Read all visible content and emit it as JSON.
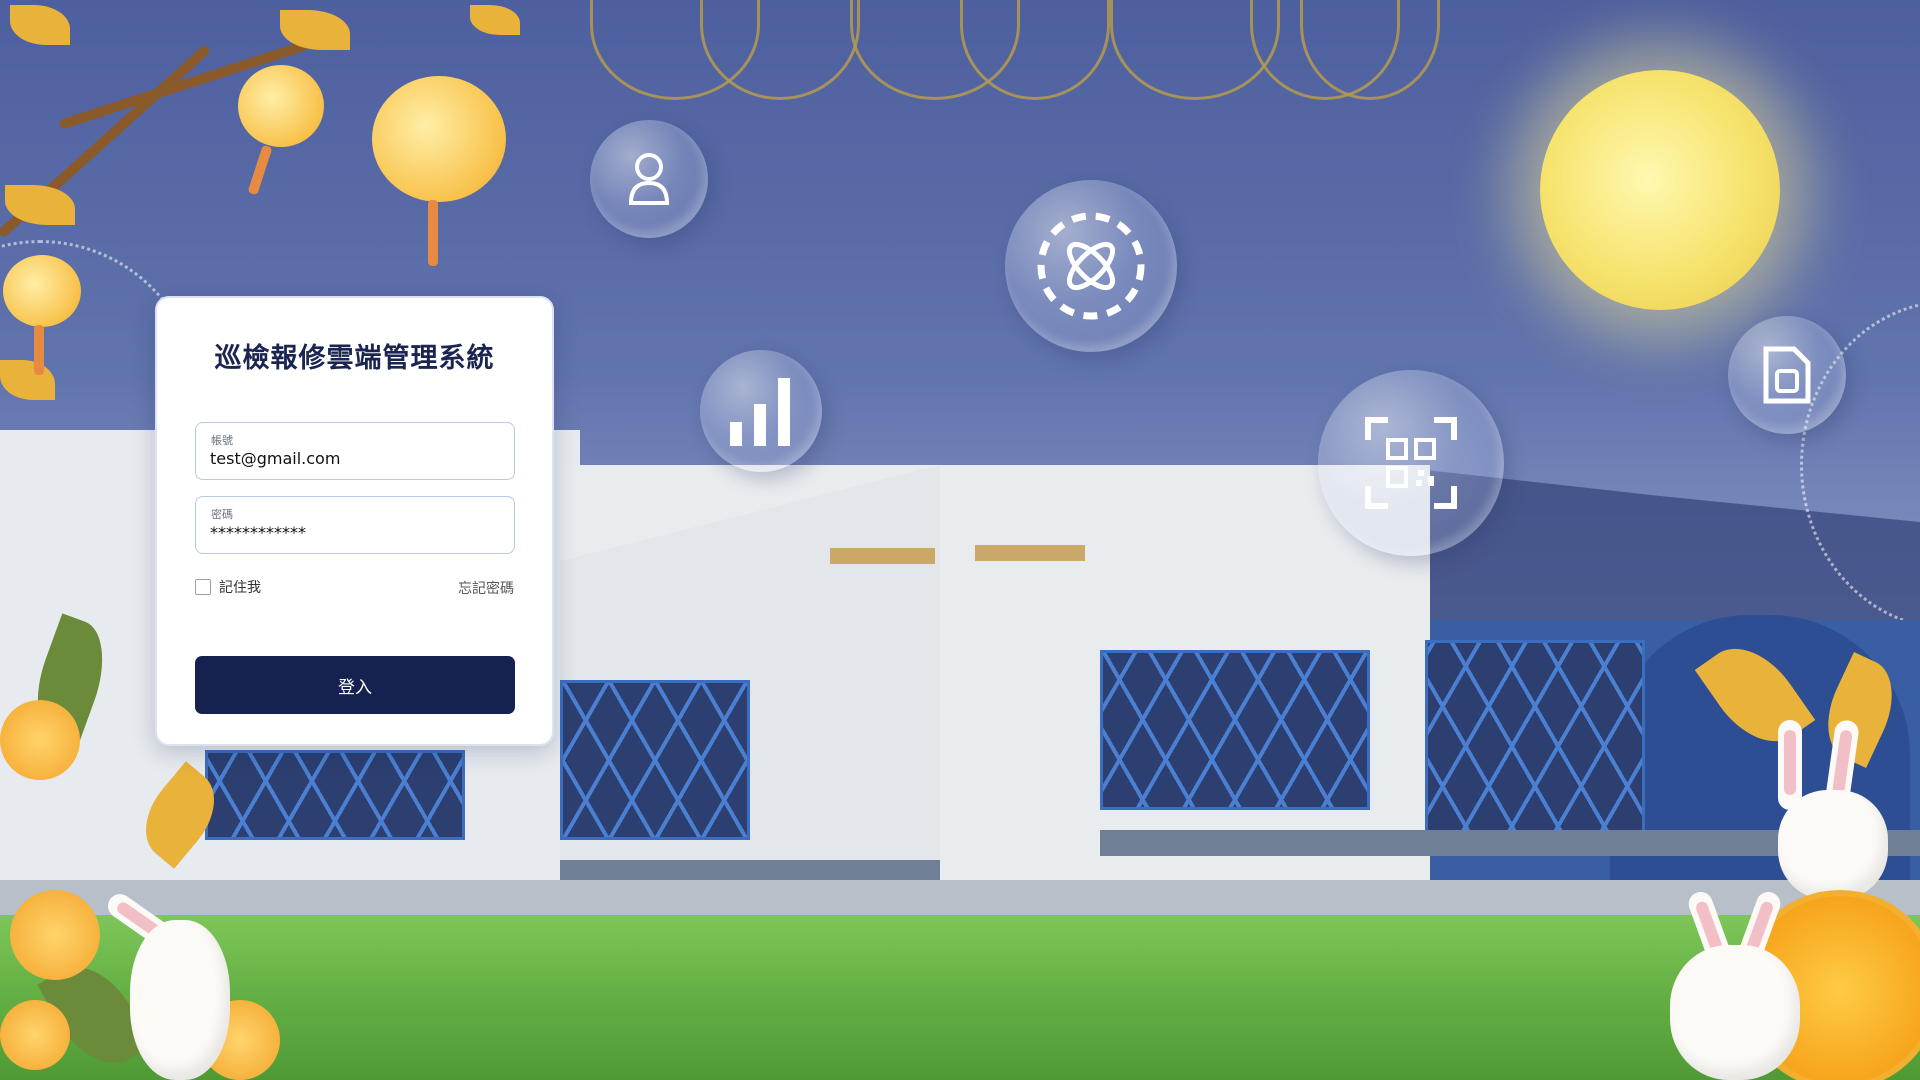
{
  "login": {
    "title": "巡檢報修雲端管理系統",
    "account_label": "帳號",
    "account_value": "test@gmail.com",
    "password_label": "密碼",
    "password_value": "************",
    "remember_label": "記住我",
    "remember_checked": false,
    "forgot_label": "忘記密碼",
    "login_button": "登入"
  },
  "colors": {
    "button_bg": "#15224f",
    "title_text": "#1b2552",
    "sky": "#5a6ca8",
    "moon": "#f6e36d"
  },
  "floating_icons": [
    "user-icon",
    "bar-chart-icon",
    "atom-icon",
    "qr-code-icon",
    "sim-card-icon"
  ]
}
